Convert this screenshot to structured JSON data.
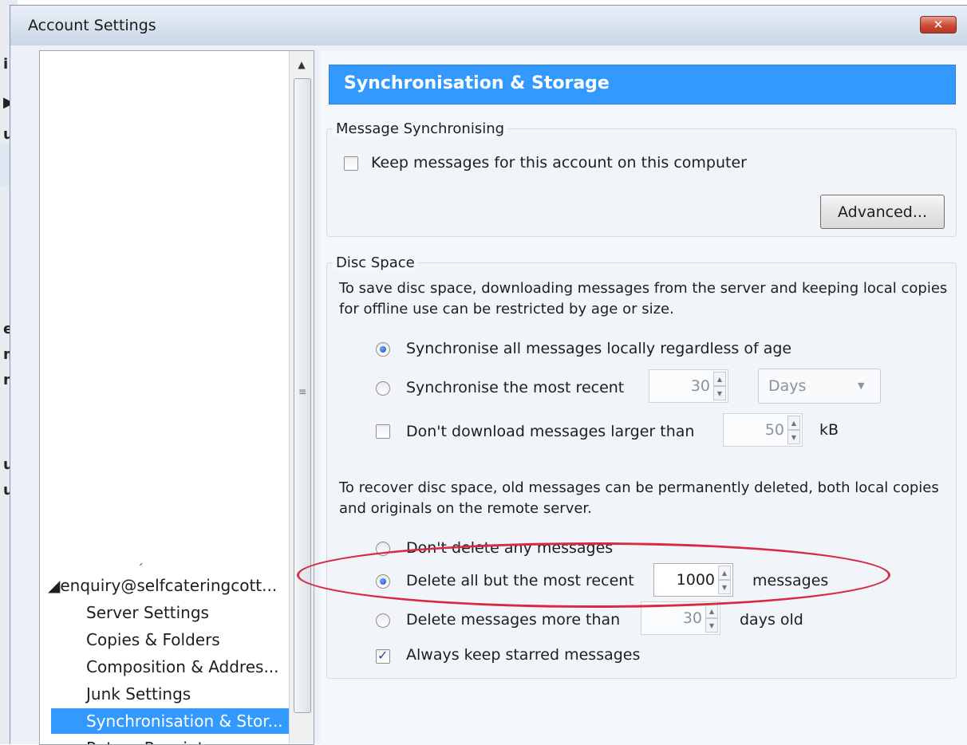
{
  "window": {
    "title": "Account Settings",
    "close_glyph": "✕",
    "background_fragments": [
      "i",
      "▶",
      "ul",
      "et",
      "m",
      "n",
      "u",
      "u"
    ]
  },
  "tree": {
    "account": "◢enquiry@selfcateringcott...",
    "items": [
      {
        "label": "Server Settings",
        "selected": false
      },
      {
        "label": "Copies & Folders",
        "selected": false
      },
      {
        "label": "Composition & Addres...",
        "selected": false
      },
      {
        "label": "Junk Settings",
        "selected": false
      },
      {
        "label": "Synchronisation & Stor...",
        "selected": true
      },
      {
        "label": "Return Receipts",
        "selected": false
      }
    ],
    "scroll_up_glyph": "▲",
    "grip_glyph": "≡"
  },
  "page": {
    "title": "Synchronisation & Storage"
  },
  "sync_group": {
    "legend": "Message Synchronising",
    "keep_messages": {
      "label": "Keep messages for this account on this computer",
      "checked": false
    },
    "advanced_button": "Advanced..."
  },
  "disc_group": {
    "legend": "Disc Space",
    "intro": "To save disc space, downloading messages from the server and keeping local copies for offline use can be restricted by age or size.",
    "sync_all": {
      "label": "Synchronise all messages locally regardless of age",
      "checked": true
    },
    "sync_recent": {
      "label": "Synchronise the most recent",
      "checked": false,
      "value": "30",
      "unit_option": "Days"
    },
    "dont_download": {
      "label": "Don't download messages larger than",
      "checked": false,
      "value": "50",
      "unit": "kB"
    },
    "recover_intro": "To recover disc space, old messages can be permanently deleted, both local copies and originals on the remote server.",
    "dont_delete": {
      "label": "Don't delete any messages",
      "checked": false
    },
    "delete_all_but": {
      "label": "Delete all but the most recent",
      "checked": true,
      "value": "1000",
      "suffix": "messages"
    },
    "delete_older": {
      "label": "Delete messages more than",
      "checked": false,
      "value": "30",
      "suffix": "days old"
    },
    "always_keep_starred": {
      "label": "Always keep starred messages",
      "checked": true
    }
  },
  "glyphs": {
    "spin_up": "▲",
    "spin_down": "▼",
    "dropdown": "▼",
    "check": "✓"
  },
  "colors": {
    "header_blue": "#3399ff",
    "selection_blue": "#3399ff",
    "highlight_red": "#d72a44",
    "close_red": "#cc4b33"
  }
}
